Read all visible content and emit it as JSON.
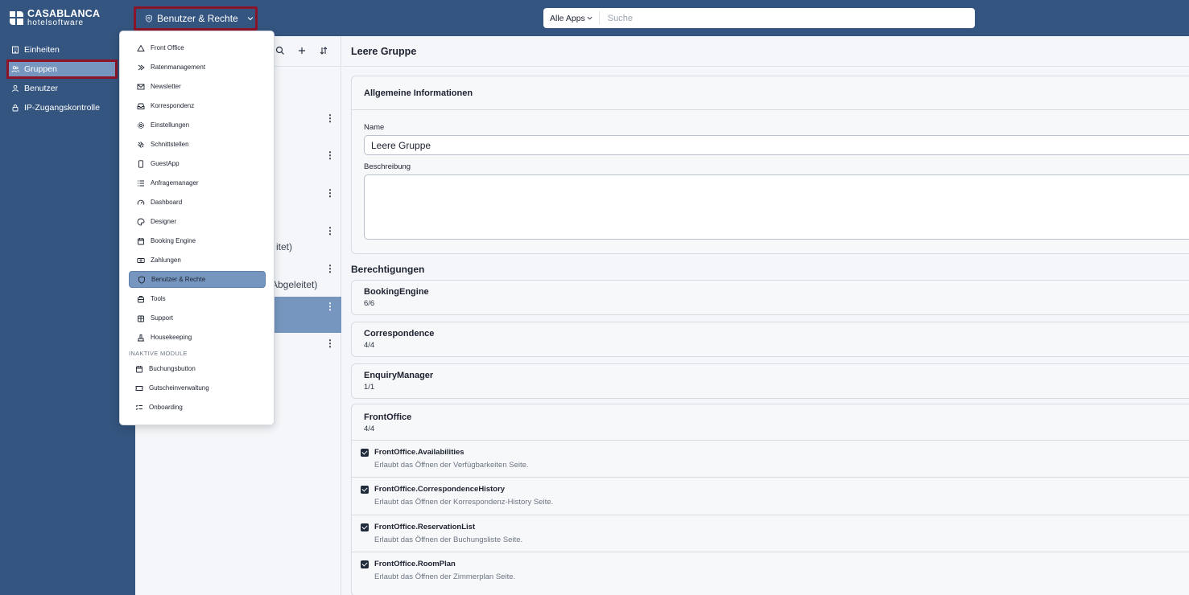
{
  "brand": {
    "name": "CASABLANCA",
    "sub": "hotelsoftware"
  },
  "app_switcher": {
    "label": "Benutzer & Rechte"
  },
  "search": {
    "scope": "Alle Apps",
    "placeholder": "Suche"
  },
  "leftnav": {
    "items": [
      {
        "label": "Einheiten",
        "icon": "building-icon"
      },
      {
        "label": "Gruppen",
        "icon": "users-icon",
        "active": true
      },
      {
        "label": "Benutzer",
        "icon": "user-icon"
      },
      {
        "label": "IP-Zugangskontrolle",
        "icon": "lock-icon"
      }
    ]
  },
  "group_list": {
    "fragments": [
      "itet)",
      "Abgeleitet)"
    ]
  },
  "dropdown": {
    "items": [
      {
        "label": "Front Office",
        "icon": "front-office-icon"
      },
      {
        "label": "Ratenmanagement",
        "icon": "rate-management-icon"
      },
      {
        "label": "Newsletter",
        "icon": "mail-icon"
      },
      {
        "label": "Korrespondenz",
        "icon": "inbox-icon"
      },
      {
        "label": "Einstellungen",
        "icon": "gear-icon"
      },
      {
        "label": "Schnittstellen",
        "icon": "plug-icon"
      },
      {
        "label": "GuestApp",
        "icon": "phone-icon"
      },
      {
        "label": "Anfragemanager",
        "icon": "list-icon"
      },
      {
        "label": "Dashboard",
        "icon": "gauge-icon"
      },
      {
        "label": "Designer",
        "icon": "palette-icon"
      },
      {
        "label": "Booking Engine",
        "icon": "calendar-icon"
      },
      {
        "label": "Zahlungen",
        "icon": "payment-icon"
      },
      {
        "label": "Benutzer & Rechte",
        "icon": "shield-icon",
        "active": true
      },
      {
        "label": "Tools",
        "icon": "toolbox-icon"
      },
      {
        "label": "Support",
        "icon": "support-icon"
      },
      {
        "label": "Housekeeping",
        "icon": "housekeeping-icon"
      }
    ],
    "section_label": "INAKTIVE MODULE",
    "inactive_items": [
      {
        "label": "Buchungsbutton",
        "icon": "calendar-icon"
      },
      {
        "label": "Gutscheinverwaltung",
        "icon": "ticket-icon"
      },
      {
        "label": "Onboarding",
        "icon": "checklist-icon"
      }
    ]
  },
  "main": {
    "title": "Leere Gruppe",
    "info_card": {
      "title": "Allgemeine Informationen",
      "name_label": "Name",
      "name_value": "Leere Gruppe",
      "desc_label": "Beschreibung",
      "desc_value": ""
    },
    "permissions_title": "Berechtigungen",
    "permissions": [
      {
        "name": "BookingEngine",
        "count": "6/6"
      },
      {
        "name": "Correspondence",
        "count": "4/4"
      },
      {
        "name": "EnquiryManager",
        "count": "1/1"
      }
    ],
    "frontoffice": {
      "name": "FrontOffice",
      "count": "4/4",
      "rights": [
        {
          "name": "FrontOffice.Availabilities",
          "desc": "Erlaubt das Öffnen der Verfügbarkeiten Seite.",
          "checked": true
        },
        {
          "name": "FrontOffice.CorrespondenceHistory",
          "desc": "Erlaubt das Öffnen der Korrespondenz-History Seite.",
          "checked": true
        },
        {
          "name": "FrontOffice.ReservationList",
          "desc": "Erlaubt das Öffnen der Buchungsliste Seite.",
          "checked": true
        },
        {
          "name": "FrontOffice.RoomPlan",
          "desc": "Erlaubt das Öffnen der Zimmerplan Seite.",
          "checked": true
        }
      ]
    }
  }
}
